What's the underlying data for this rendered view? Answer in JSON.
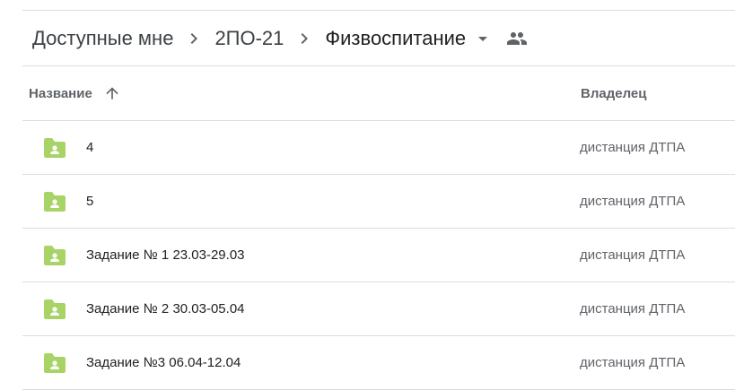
{
  "breadcrumb": {
    "items": [
      {
        "label": "Доступные мне"
      },
      {
        "label": "2ПО-21"
      },
      {
        "label": "Физвоспитание"
      }
    ]
  },
  "table": {
    "columns": {
      "name": "Название",
      "owner": "Владелец"
    },
    "rows": [
      {
        "name": "4",
        "owner": "дистанция ДТПА"
      },
      {
        "name": "5",
        "owner": "дистанция ДТПА"
      },
      {
        "name": "Задание № 1 23.03-29.03",
        "owner": "дистанция ДТПА"
      },
      {
        "name": "Задание № 2 30.03-05.04",
        "owner": "дистанция ДТПА"
      },
      {
        "name": "Задание №3 06.04-12.04",
        "owner": "дистанция ДТПА"
      }
    ]
  },
  "colors": {
    "folder": "#a8d467",
    "text_primary": "#202124",
    "text_secondary": "#5f6368",
    "divider": "#dadce0"
  },
  "icons": {
    "breadcrumb_separator": "chevron-right-icon",
    "dropdown": "arrow-drop-down-icon",
    "shared": "people-icon",
    "sort": "arrow-upward-icon",
    "row": "shared-folder-icon"
  }
}
